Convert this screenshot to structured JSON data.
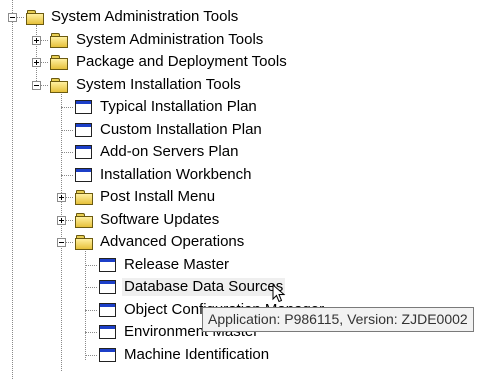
{
  "tree": {
    "root_label": "System Administration Tools",
    "nodes": [
      {
        "label": "System Administration Tools"
      },
      {
        "label": "Package and Deployment Tools"
      },
      {
        "label": "System Installation Tools"
      },
      {
        "label": "Typical Installation Plan"
      },
      {
        "label": "Custom Installation Plan"
      },
      {
        "label": "Add-on Servers Plan"
      },
      {
        "label": "Installation Workbench"
      },
      {
        "label": "Post Install Menu"
      },
      {
        "label": "Software Updates"
      },
      {
        "label": "Advanced Operations"
      },
      {
        "label": "Release Master"
      },
      {
        "label": "Database Data Sources"
      },
      {
        "label": "Object Configuration Manager"
      },
      {
        "label": "Environment Master"
      },
      {
        "label": "Machine Identification"
      }
    ]
  },
  "tooltip": {
    "text": "Application: P986115,  Version: ZJDE0002"
  },
  "icons": {
    "folder": "folder-icon",
    "application": "application-window-icon",
    "expand": "plus-expander-icon",
    "collapse": "minus-expander-icon",
    "cursor": "mouse-pointer-icon"
  },
  "colors": {
    "folder_fill": "#e6c13a",
    "window_titlebar": "#1c3fc8",
    "tooltip_bg": "#f2f2f2"
  }
}
